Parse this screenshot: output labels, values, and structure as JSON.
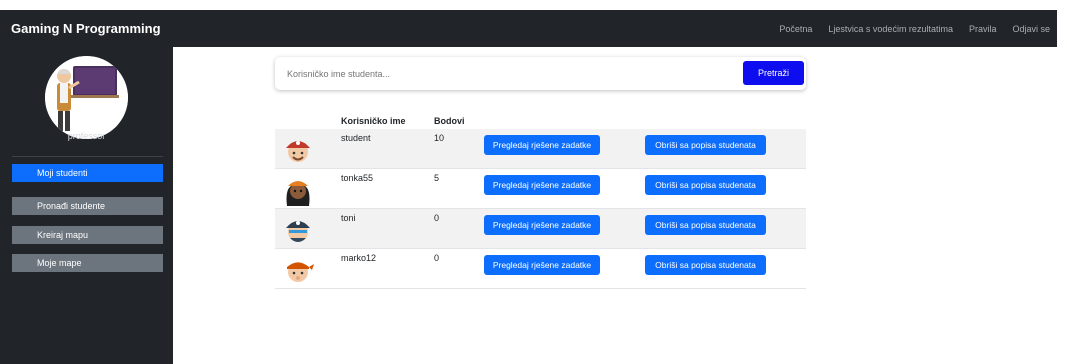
{
  "navbar": {
    "brand": "Gaming N Programming",
    "links": [
      "Početna",
      "Ljestvica s vodećim rezultatima",
      "Pravila",
      "Odjavi se"
    ]
  },
  "sidebar": {
    "profile_name": "professor",
    "items": [
      {
        "label": "Moji studenti",
        "active": true
      },
      {
        "label": "Pronađi studente",
        "active": false
      },
      {
        "label": "Kreiraj mapu",
        "active": false
      },
      {
        "label": "Moje mape",
        "active": false
      }
    ]
  },
  "search": {
    "placeholder": "Korisničko ime studenta...",
    "button_label": "Pretraži"
  },
  "table": {
    "headers": {
      "username": "Korisničko ime",
      "points": "Bodovi"
    },
    "rows": [
      {
        "username": "student",
        "points": "10",
        "view_label": "Pregledaj rješene zadatke",
        "delete_label": "Obriši sa popisa studenata"
      },
      {
        "username": "tonka55",
        "points": "5",
        "view_label": "Pregledaj rješene zadatke",
        "delete_label": "Obriši sa popisa studenata"
      },
      {
        "username": "toni",
        "points": "0",
        "view_label": "Pregledaj rješene zadatke",
        "delete_label": "Obriši sa popisa studenata"
      },
      {
        "username": "marko12",
        "points": "0",
        "view_label": "Pregledaj rješene zadatke",
        "delete_label": "Obriši sa popisa studenata"
      }
    ]
  },
  "colors": {
    "navbar_bg": "#212529",
    "primary": "#0d6efd",
    "secondary": "#6c757d"
  },
  "icons": [
    "professor-avatar-icon",
    "pirate-avatar-icon"
  ]
}
